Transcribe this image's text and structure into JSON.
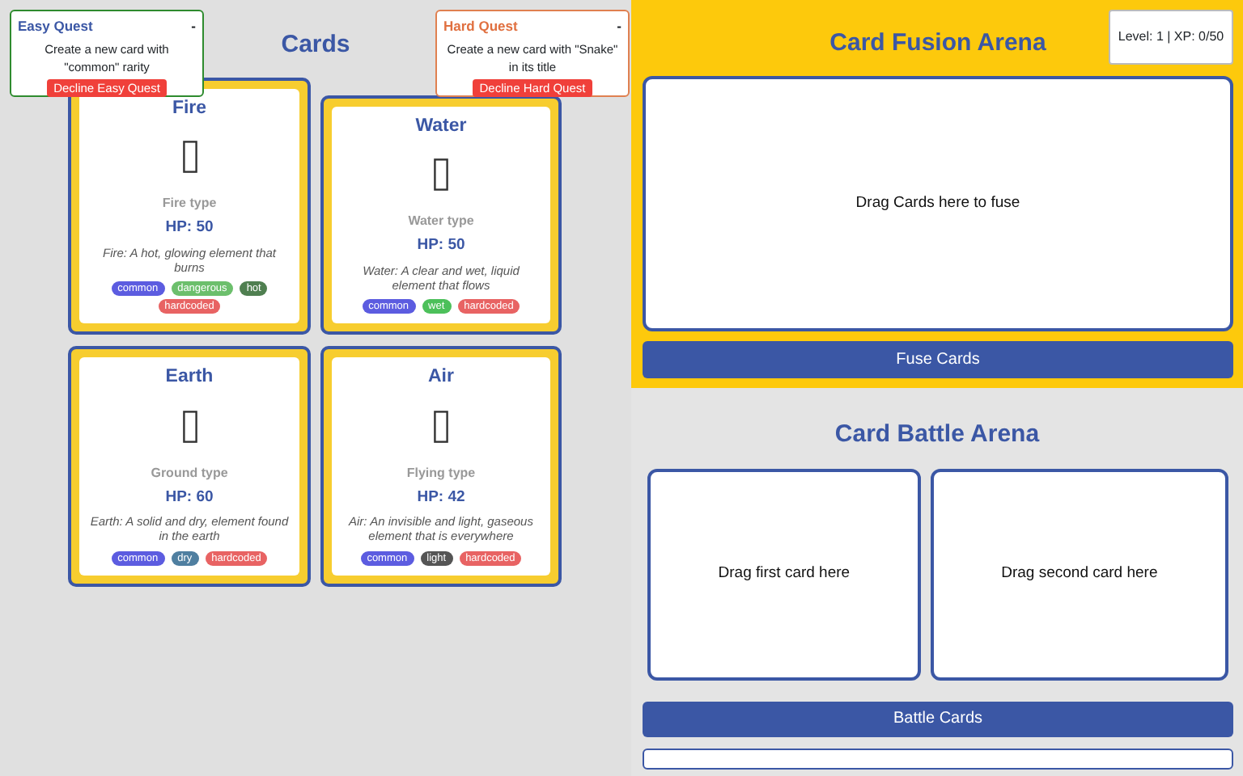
{
  "cards_panel": {
    "title": "Cards",
    "quests": [
      {
        "kind": "easy",
        "title": "Easy Quest",
        "toggle": "-",
        "description": "Create a new card with \"common\" rarity",
        "button": "Decline Easy Quest"
      },
      {
        "kind": "hard",
        "title": "Hard Quest",
        "toggle": "-",
        "description": "Create a new card with \"Snake\" in its title",
        "button": "Decline Hard Quest"
      }
    ],
    "cards": [
      {
        "name": "Fire",
        "type": "Fire type",
        "hp": "HP: 50",
        "description": "Fire: A hot, glowing element that burns",
        "tags": [
          {
            "label": "common",
            "color": "#5c5ce0"
          },
          {
            "label": "dangerous",
            "color": "#6cbf6c"
          },
          {
            "label": "hot",
            "color": "#4f7f50"
          },
          {
            "label": "hardcoded",
            "color": "#e86363"
          }
        ]
      },
      {
        "name": "Water",
        "type": "Water type",
        "hp": "HP: 50",
        "description": "Water: A clear and wet, liquid element that flows",
        "tags": [
          {
            "label": "common",
            "color": "#5c5ce0"
          },
          {
            "label": "wet",
            "color": "#4cc05a"
          },
          {
            "label": "hardcoded",
            "color": "#e86363"
          }
        ]
      },
      {
        "name": "Earth",
        "type": "Ground type",
        "hp": "HP: 60",
        "description": "Earth: A solid and dry, element found in the earth",
        "tags": [
          {
            "label": "common",
            "color": "#5c5ce0"
          },
          {
            "label": "dry",
            "color": "#4f7fa0"
          },
          {
            "label": "hardcoded",
            "color": "#e86363"
          }
        ]
      },
      {
        "name": "Air",
        "type": "Flying type",
        "hp": "HP: 42",
        "description": "Air: An invisible and light, gaseous element that is everywhere",
        "tags": [
          {
            "label": "common",
            "color": "#5c5ce0"
          },
          {
            "label": "light",
            "color": "#555555"
          },
          {
            "label": "hardcoded",
            "color": "#e86363"
          }
        ]
      }
    ]
  },
  "fusion_arena": {
    "title": "Card Fusion Arena",
    "status": "Level: 1 | XP: 0/50",
    "drop_zone": "Drag Cards here to fuse",
    "button": "Fuse Cards"
  },
  "battle_arena": {
    "title": "Card Battle Arena",
    "drop_zones": [
      "Drag first card here",
      "Drag second card here"
    ],
    "button": "Battle Cards"
  }
}
